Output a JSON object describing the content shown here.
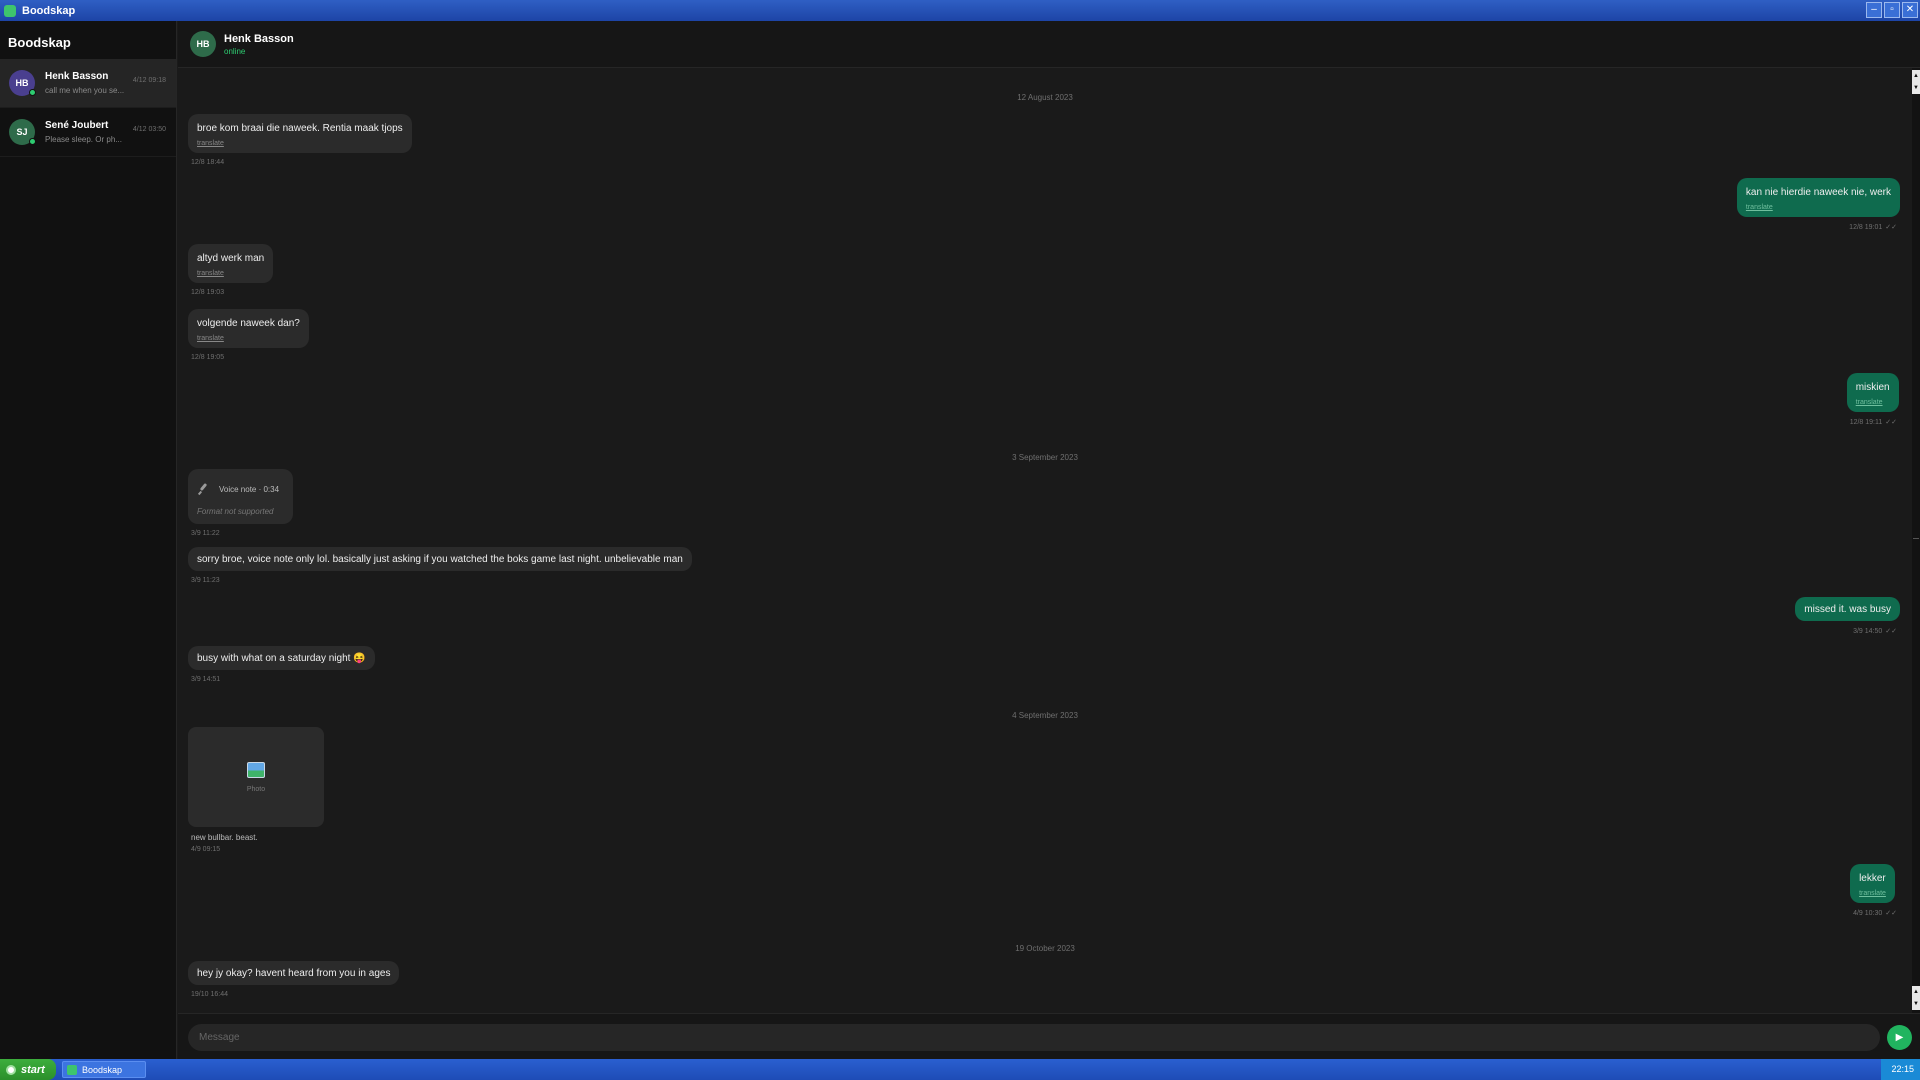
{
  "window": {
    "title": "Boodskap",
    "minimize": "–",
    "maximize": "▫",
    "close": "✕"
  },
  "sidebar": {
    "title": "Boodskap",
    "chats": [
      {
        "initials": "HB",
        "name": "Henk Basson",
        "preview": "call me when you se...",
        "time": "4/12 09:18",
        "avatar_color": "#4a3f8f"
      },
      {
        "initials": "SJ",
        "name": "Sené Joubert",
        "preview": "Please sleep. Or ph...",
        "time": "4/12 03:50",
        "avatar_color": "#2e6b4a"
      }
    ]
  },
  "header": {
    "initials": "HB",
    "name": "Henk Basson",
    "status": "online"
  },
  "dates": [
    "12 August 2023",
    "3 September 2023",
    "4 September 2023",
    "19 October 2023"
  ],
  "messages": [
    {
      "text": "broe kom braai die naweek. Rentia maak tjops",
      "translate": "translate",
      "time": "12/8 18:44"
    },
    {
      "text": "kan nie hierdie naweek nie, werk",
      "translate": "translate",
      "time": "12/8 19:01",
      "ticks": "✓✓"
    },
    {
      "text": "altyd werk man",
      "translate": "translate",
      "time": "12/8 19:03"
    },
    {
      "text": "volgende naweek dan?",
      "translate": "translate",
      "time": "12/8 19:05"
    },
    {
      "text": "miskien",
      "translate": "translate",
      "time": "12/8 19:11",
      "ticks": "✓✓"
    },
    {
      "voice_label": "Voice note · 0:34",
      "unsupported": "Format not supported",
      "time": "3/9 11:22"
    },
    {
      "text": "sorry broe, voice note only lol. basically just asking if you watched the boks game last night. unbelievable man",
      "time": "3/9 11:23"
    },
    {
      "text": "missed it. was busy",
      "time": "3/9 14:50",
      "ticks": "✓✓"
    },
    {
      "text": "busy with what on a saturday night 😝",
      "time": "3/9 14:51"
    },
    {
      "photo_label": "Photo",
      "caption": "new bullbar. beast.",
      "time": "4/9 09:15"
    },
    {
      "text": "lekker",
      "translate": "translate",
      "time": "4/9 10:30",
      "ticks": "✓✓"
    },
    {
      "text": "hey jy okay? havent heard from you in ages",
      "time": "19/10 16:44"
    }
  ],
  "composer": {
    "placeholder": "Message",
    "send_icon": "▶"
  },
  "taskbar": {
    "start": "start",
    "task": "Boodskap",
    "clock": "22:15"
  },
  "colors": {
    "accent": "#21b45f",
    "outgoing_bubble": "#0f6b4e",
    "incoming_bubble": "#2b2b2b",
    "online": "#2ecc71"
  }
}
